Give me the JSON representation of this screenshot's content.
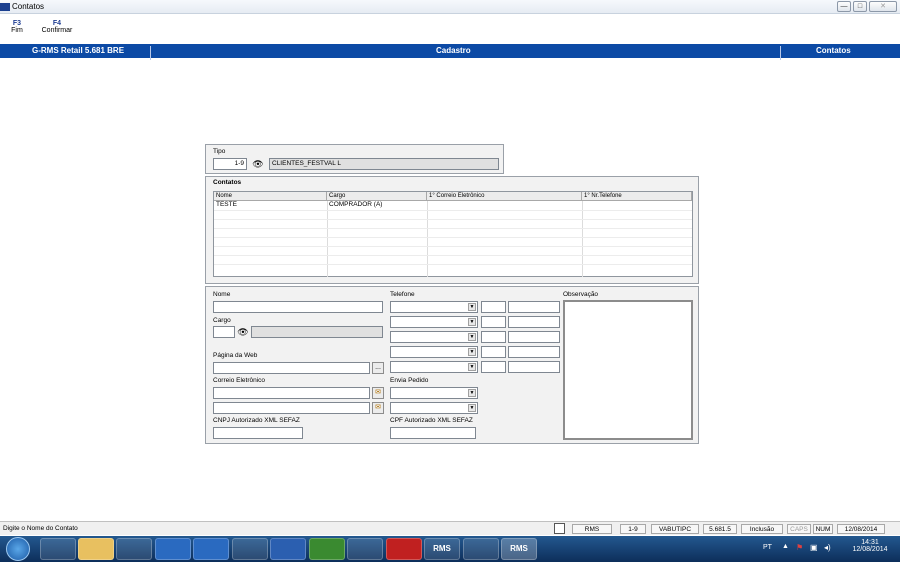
{
  "window": {
    "title": "Contatos",
    "min": "—",
    "max": "□",
    "close": "✕"
  },
  "fkeys": [
    {
      "key": "F3",
      "label": "Fim"
    },
    {
      "key": "F4",
      "label": "Confirmar"
    }
  ],
  "header": {
    "left": "G-RMS Retail 5.681 BRE",
    "center": "Cadastro",
    "right": "Contatos"
  },
  "tipo": {
    "label": "Tipo",
    "code": "1-9",
    "desc": "CLIENTES_FESTVAL L"
  },
  "contatos": {
    "label": "Contatos",
    "columns": [
      "Nome",
      "Cargo",
      "1° Correio Eletrônico",
      "1° Nr.Telefone"
    ],
    "rows": [
      [
        "TESTE",
        "COMPRADOR (A)",
        "",
        ""
      ]
    ]
  },
  "form": {
    "nome_label": "Nome",
    "cargo_label": "Cargo",
    "pagina_label": "Página da Web",
    "pagina_btn": "...",
    "correio_label": "Correio Eletrônico",
    "cnpj_label": "CNPJ Autorizado XML SEFAZ",
    "telefone_label": "Telefone",
    "envia_label": "Envia Pedido",
    "cpf_label": "CPF Autorizado XML SEFAZ",
    "obs_label": "Observação"
  },
  "status": {
    "message": "Digite o Nome do Contato",
    "app": "RMS",
    "code": "1-9",
    "host": "VABUTIPC",
    "version": "5.681.5",
    "mode": "Inclusão",
    "caps": "CAPS",
    "num": "NUM",
    "date": "12/08/2014"
  },
  "taskbar": {
    "apps": [
      "",
      "",
      "",
      "",
      "",
      "",
      "",
      "",
      "",
      "",
      "RMS",
      "",
      "RMS"
    ],
    "tray_lang": "PT",
    "time": "14:31",
    "date": "12/08/2014"
  },
  "colors": {
    "header": "#0c4aa5",
    "taskbar": "#1b4a80"
  }
}
